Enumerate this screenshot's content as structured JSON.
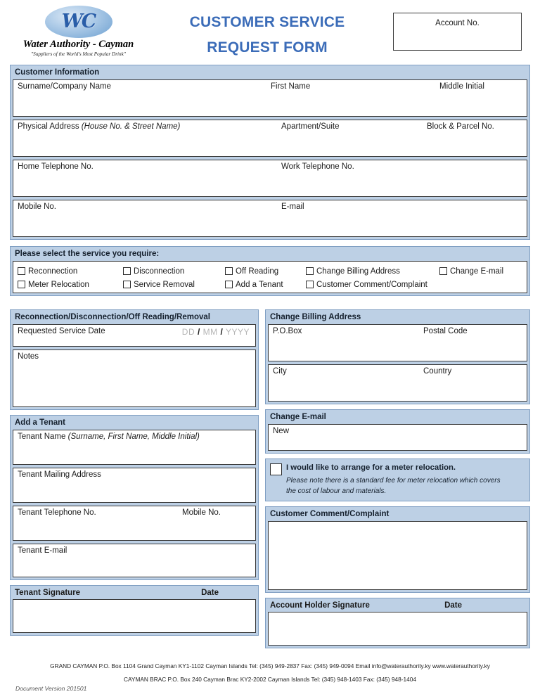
{
  "header": {
    "logo": {
      "monogram": "WC",
      "name": "Water Authority - Cayman",
      "tagline": "\"Suppliers of the World's Most Popular Drink\""
    },
    "title_line1": "CUSTOMER SERVICE",
    "title_line2": "REQUEST FORM",
    "title_color": "#3b6cb8",
    "account_no_label": "Account No."
  },
  "customer_information": {
    "section_title": "Customer Information",
    "rows": [
      {
        "c1": "Surname/Company Name",
        "c2": "First Name",
        "c3": "Middle Initial"
      },
      {
        "c1": "Physical Address ",
        "c1_italic": "(House No. & Street Name)",
        "c2": "Apartment/Suite",
        "c3": "Block & Parcel No."
      },
      {
        "c1": "Home Telephone No.",
        "c2": "Work Telephone No.",
        "c3": ""
      },
      {
        "c1": "Mobile No.",
        "c2": "E-mail",
        "c3": ""
      }
    ]
  },
  "service_select": {
    "section_title": "Please select the service you require:",
    "row1": [
      "Reconnection",
      "Disconnection",
      "Off Reading",
      "Change Billing Address",
      "Change E-mail"
    ],
    "row2": [
      "Meter Relocation",
      "Service Removal",
      "Add a Tenant",
      "Customer Comment/Complaint"
    ]
  },
  "reconnection": {
    "section_title": "Reconnection/Disconnection/Off Reading/Removal",
    "date_label": "Requested Service Date",
    "date_placeholder": {
      "dd": "DD",
      "sep": "/",
      "mm": "MM",
      "yyyy": "YYYY"
    },
    "notes_label": "Notes"
  },
  "add_tenant": {
    "section_title": "Add a Tenant",
    "name_label": "Tenant Name ",
    "name_label_italic": "(Surname, First Name, Middle Initial)",
    "mailing_label": "Tenant Mailing Address",
    "telephone_label": "Tenant Telephone No.",
    "mobile_label": "Mobile No.",
    "email_label": "Tenant E-mail"
  },
  "tenant_signature": {
    "signature_label": "Tenant Signature",
    "date_label": "Date"
  },
  "billing_address": {
    "section_title": "Change Billing Address",
    "pobox_label": "P.O.Box",
    "postal_label": "Postal Code",
    "city_label": "City",
    "country_label": "Country"
  },
  "change_email": {
    "section_title": "Change E-mail",
    "new_label": "New"
  },
  "meter_relocation": {
    "checkbox_label": "I would like to arrange for a meter relocation.",
    "note_line1": "Please note there is a standard fee for meter relocation which covers",
    "note_line2": "the cost of labour and materials."
  },
  "comment": {
    "section_title": "Customer Comment/Complaint"
  },
  "account_holder_signature": {
    "signature_label": "Account Holder Signature",
    "date_label": "Date"
  },
  "footer": {
    "line1": "GRAND CAYMAN P.O. Box 1104 Grand Cayman KY1-1102 Cayman Islands Tel: (345) 949-2837 Fax: (345) 949-0094 Email info@waterauthority.ky www.waterauthority.ky",
    "line2": "CAYMAN BRAC P.O. Box 240 Cayman Brac KY2-2002 Cayman Islands Tel: (345) 948-1403 Fax: (345) 948-1404",
    "document_version": "Document Version 201501"
  },
  "colors": {
    "panel_band": "#bdd0e5",
    "panel_border": "#7f9ec2",
    "field_border": "#3a3a3a",
    "title_blue": "#3b6cb8"
  }
}
